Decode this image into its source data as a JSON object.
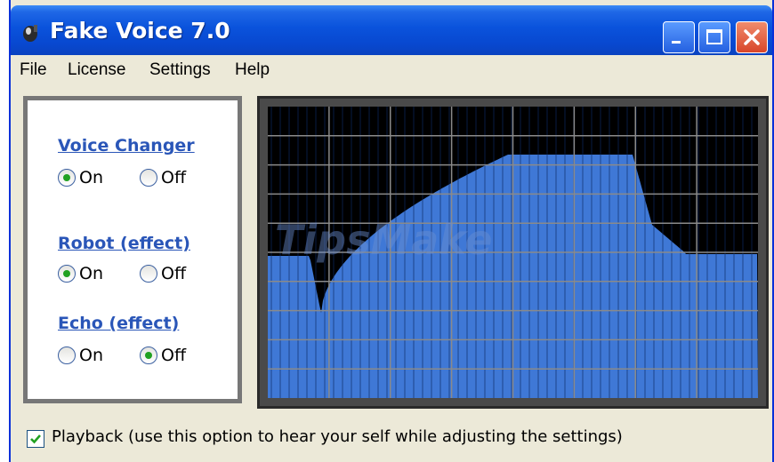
{
  "app": {
    "title": "Fake Voice 7.0",
    "icon": "app-icon"
  },
  "menu": {
    "items": [
      "File",
      "License",
      "Settings",
      "Help"
    ]
  },
  "groups": [
    {
      "title": "Voice Changer",
      "on_label": "On",
      "off_label": "Off",
      "selected": "On"
    },
    {
      "title": "Robot (effect)",
      "on_label": "On",
      "off_label": "Off",
      "selected": "On"
    },
    {
      "title": "Echo (effect)",
      "on_label": "On",
      "off_label": "Off",
      "selected": "Off"
    }
  ],
  "playback": {
    "label": "Playback (use this option to hear your self while adjusting the settings)",
    "checked": true
  },
  "visualizer": {
    "background": "#000000",
    "grid_color": "#8a8a8a",
    "bar_color": "#3f78d6"
  },
  "watermark": "TipsMake"
}
